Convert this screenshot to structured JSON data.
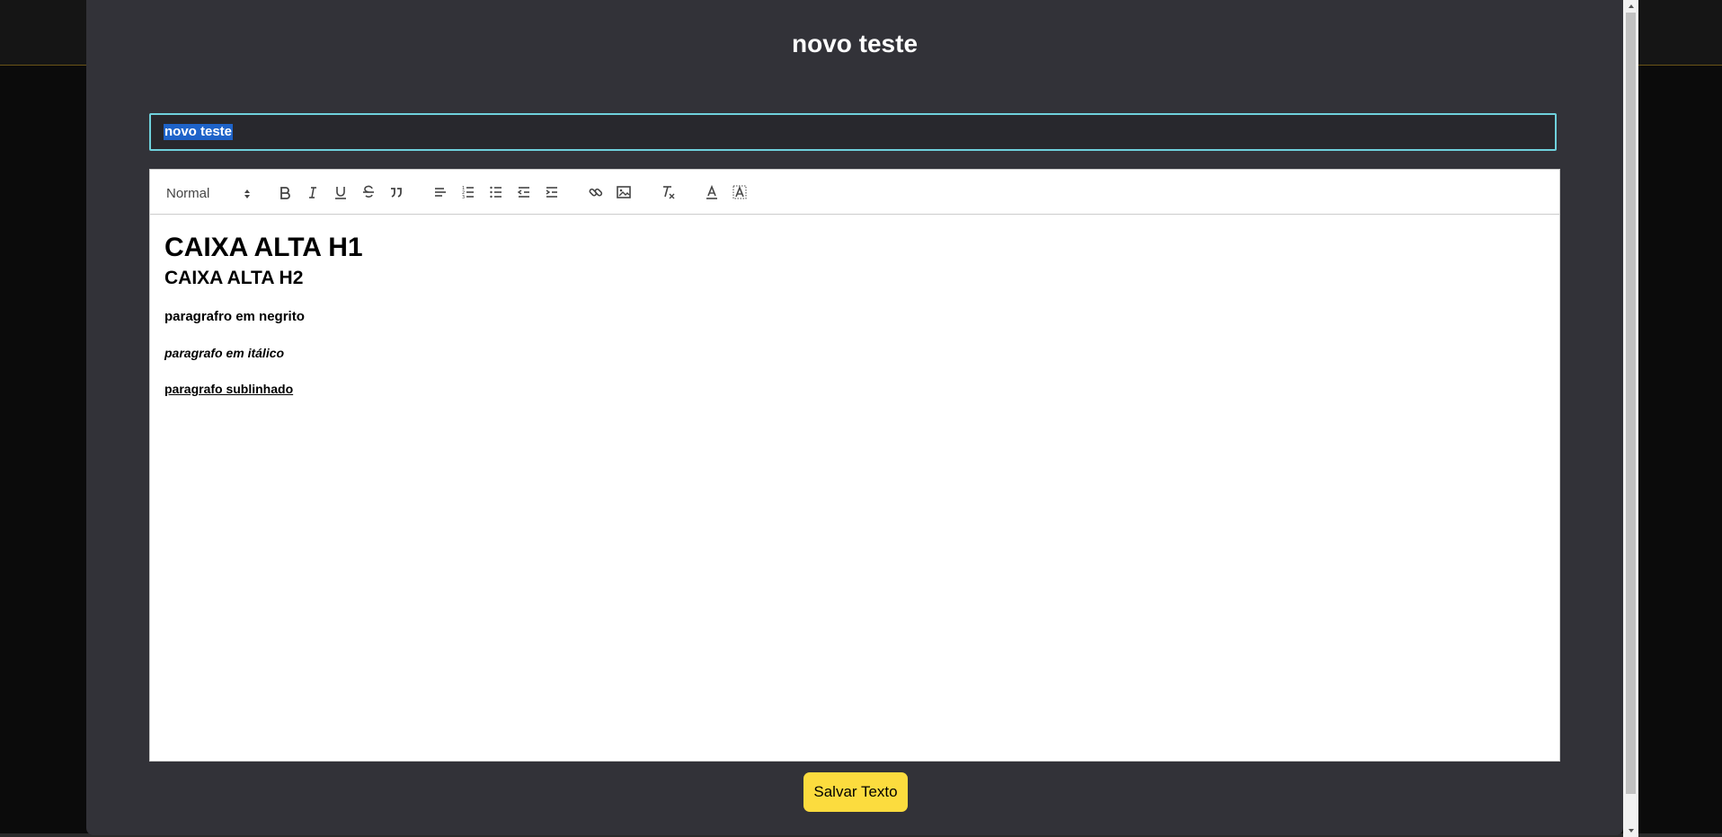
{
  "modal": {
    "title": "novo teste"
  },
  "title_input": {
    "value": "novo teste"
  },
  "toolbar": {
    "header_select": "Normal",
    "buttons": [
      "bold-icon",
      "italic-icon",
      "underline-icon",
      "strike-icon",
      "blockquote-icon",
      "align-left-icon",
      "ordered-list-icon",
      "bullet-list-icon",
      "outdent-icon",
      "indent-icon",
      "link-icon",
      "image-icon",
      "clear-format-icon",
      "text-color-icon",
      "background-color-icon"
    ]
  },
  "content": {
    "h1": "CAIXA ALTA H1",
    "h2": "CAIXA ALTA H2",
    "p_bold": "paragrafro em negrito",
    "p_italic": "paragrafo em itálico",
    "p_underline": "paragrafo sublinhado"
  },
  "save_button": {
    "label": "Salvar Texto"
  },
  "colors": {
    "modal_bg": "#323238",
    "accent_yellow": "#fcdc3e",
    "input_border": "#6fd1dc",
    "selection": "#1e63c9"
  }
}
